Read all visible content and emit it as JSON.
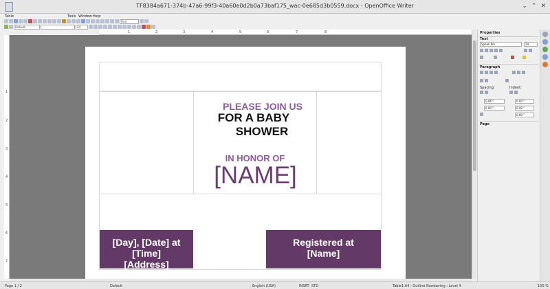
{
  "window": {
    "title": "TF8384a671-374b-47a6-99f3-40a60e0d2b0a73baf175_wac-0e685d3b0559.docx - OpenOffice Writer",
    "controls": [
      "⌄",
      "⌃",
      "✕"
    ]
  },
  "menubar": {
    "items": [
      "Table",
      "Tools",
      "Window",
      "Help"
    ]
  },
  "toolbar": {
    "find_placeholder": "Find",
    "paragraph_style": "Default",
    "font_name": "",
    "font_size": "24"
  },
  "ruler": {
    "marks": [
      "1",
      "2",
      "3",
      "4",
      "5",
      "6",
      "7",
      "8"
    ],
    "vmarks": [
      "1",
      "2",
      "3",
      "4",
      "5",
      "6",
      "7"
    ]
  },
  "document": {
    "line1": "PLEASE JOIN US",
    "line2": "FOR A BABY",
    "line3": "SHOWER",
    "line4": "IN HONOR OF",
    "line5": "[NAME]",
    "left_box": [
      "[Day], [Date] at",
      "[Time]",
      "[Address]"
    ],
    "right_box": [
      "Registered at",
      "[Name]"
    ],
    "accent_color": "#633a67",
    "text_accent": "#8e5a9a"
  },
  "sidebar": {
    "title": "Properties",
    "text_section": "Text",
    "font_name": "Speak Pro",
    "font_size": "24",
    "paragraph_section": "Paragraph",
    "spacing_label": "Spacing:",
    "indent_label": "Indent:",
    "spacing_above": "0.06 \"",
    "spacing_below": "0.00 \"",
    "indent_before": "0.00 \"",
    "indent_after": "0.00 \"",
    "indent_first": "0.00 \"",
    "page_section": "Page"
  },
  "statusbar": {
    "page": "Page 1 / 2",
    "style": "Default",
    "language": "English (USA)",
    "insert": "INSRT",
    "selection": "STD",
    "context": "Table1:A4 : Outline Numbering : Level 4",
    "zoom": "100 %"
  }
}
